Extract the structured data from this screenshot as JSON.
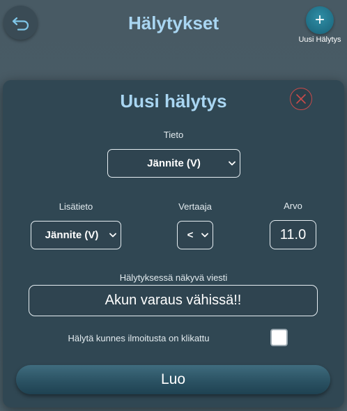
{
  "header": {
    "title": "Hälytykset",
    "back_icon": "back-arrow-icon",
    "new_alert_button_glyph": "+",
    "new_alert_label": "Uusi Hälytys"
  },
  "modal": {
    "title": "Uusi hälytys",
    "close_icon": "close-x-icon",
    "tieto": {
      "label": "Tieto",
      "selected": "Jännite (V)"
    },
    "lisatieto": {
      "label": "Lisätieto",
      "selected": "Jännite (V)"
    },
    "vertaaja": {
      "label": "Vertaaja",
      "selected": "<"
    },
    "arvo": {
      "label": "Arvo",
      "value": "11.0"
    },
    "message": {
      "label": "Hälytyksessä näkyvä viesti",
      "value": "Akun varaus vähissä!!"
    },
    "repeat_until_clicked": {
      "label": "Hälytä kunnes ilmoitusta on klikattu",
      "checked": false
    },
    "create_button_label": "Luo"
  },
  "colors": {
    "accent_title": "#a9d6f2",
    "close_red": "#c84b4b",
    "fab_teal": "#1f6e85"
  }
}
